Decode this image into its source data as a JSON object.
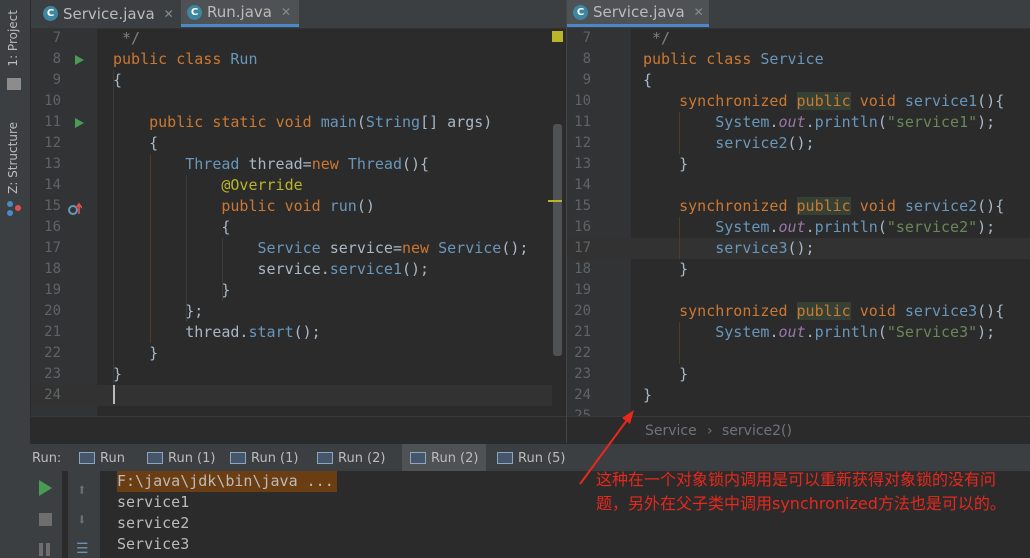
{
  "sidebar": {
    "project_tab": "1: Project",
    "structure_tab": "Z: Structure"
  },
  "left_editor": {
    "tabs": [
      {
        "label": "Service.java"
      },
      {
        "label": "Run.java"
      }
    ],
    "lines": [
      {
        "no": "7",
        "text": " */"
      },
      {
        "no": "8",
        "text": "public class Run"
      },
      {
        "no": "9",
        "text": "{"
      },
      {
        "no": "10",
        "text": ""
      },
      {
        "no": "11",
        "text": "    public static void main(String[] args)"
      },
      {
        "no": "12",
        "text": "    {"
      },
      {
        "no": "13",
        "text": "        Thread thread=new Thread(){"
      },
      {
        "no": "14",
        "text": "            @Override"
      },
      {
        "no": "15",
        "text": "            public void run()"
      },
      {
        "no": "16",
        "text": "            {"
      },
      {
        "no": "17",
        "text": "                Service service=new Service();"
      },
      {
        "no": "18",
        "text": "                service.service1();"
      },
      {
        "no": "19",
        "text": "            }"
      },
      {
        "no": "20",
        "text": "        };"
      },
      {
        "no": "21",
        "text": "        thread.start();"
      },
      {
        "no": "22",
        "text": "    }"
      },
      {
        "no": "23",
        "text": "}"
      },
      {
        "no": "24",
        "text": ""
      }
    ]
  },
  "right_editor": {
    "tabs": [
      {
        "label": "Service.java"
      }
    ],
    "lines": [
      {
        "no": "7",
        "text": " */"
      },
      {
        "no": "8",
        "text": "public class Service"
      },
      {
        "no": "9",
        "text": "{"
      },
      {
        "no": "10",
        "text": "    synchronized public void service1(){"
      },
      {
        "no": "11",
        "text": "        System.out.println(\"service1\");"
      },
      {
        "no": "12",
        "text": "        service2();"
      },
      {
        "no": "13",
        "text": "    }"
      },
      {
        "no": "14",
        "text": ""
      },
      {
        "no": "15",
        "text": "    synchronized public void service2(){"
      },
      {
        "no": "16",
        "text": "        System.out.println(\"service2\");"
      },
      {
        "no": "17",
        "text": "        service3();"
      },
      {
        "no": "18",
        "text": "    }"
      },
      {
        "no": "19",
        "text": ""
      },
      {
        "no": "20",
        "text": "    synchronized public void service3(){"
      },
      {
        "no": "21",
        "text": "        System.out.println(\"Service3\");"
      },
      {
        "no": "22",
        "text": ""
      },
      {
        "no": "23",
        "text": "    }"
      },
      {
        "no": "24",
        "text": "}"
      },
      {
        "no": "25",
        "text": ""
      }
    ],
    "breadcrumb": [
      "Service",
      "service2()"
    ]
  },
  "run_panel": {
    "label": "Run:",
    "tabs": [
      "Run",
      "Run (1)",
      "Run (1)",
      "Run (2)",
      "Run (2)",
      "Run (5)"
    ],
    "output": [
      "F:\\java\\jdk\\bin\\java ...",
      "service1",
      "service2",
      "Service3"
    ]
  },
  "annotation": {
    "text": "这种在一个对象锁内调用是可以重新获得对象锁的没有问题，另外在父子类中调用synchronized方法也是可以的。",
    "color": "#e8281d"
  },
  "colors": {
    "keyword": "#cc7832",
    "type": "#6897bb",
    "string": "#6a8759",
    "annotation": "#bbb529",
    "editor_bg": "#2b2b2b"
  }
}
